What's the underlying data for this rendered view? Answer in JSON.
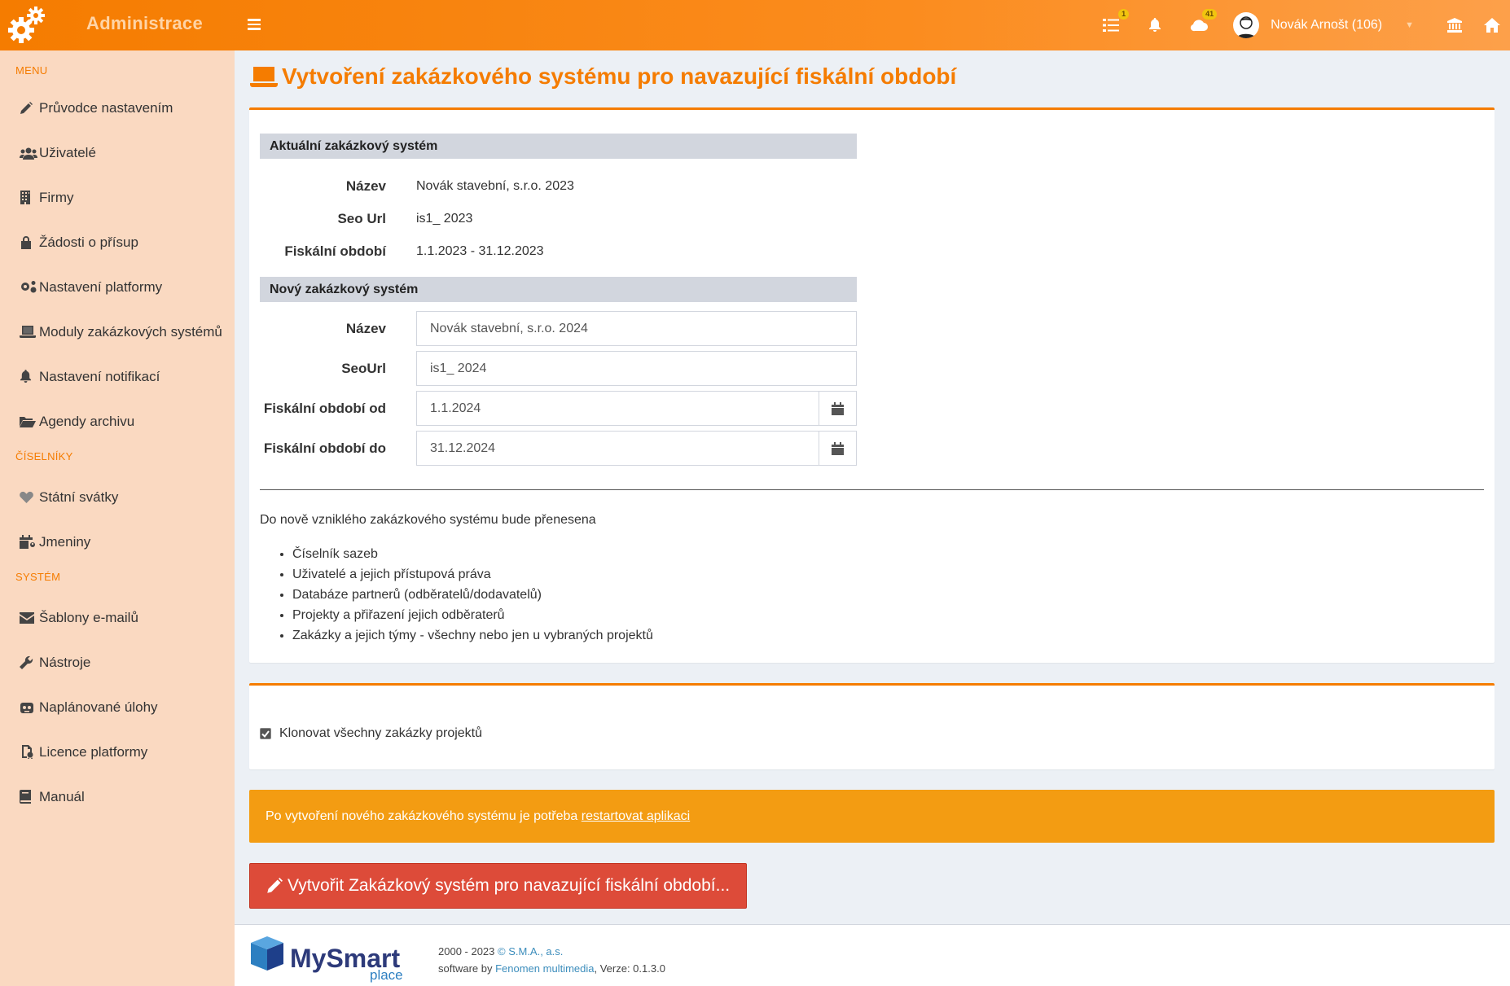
{
  "header": {
    "brand": "Administrace",
    "tasks_badge": "1",
    "messages_badge": "41",
    "user_name": "Novák Arnošt (106)"
  },
  "sidebar": {
    "menu_title": "MENU",
    "items_menu": [
      {
        "label": "Průvodce nastavením",
        "icon": "pencil-icon"
      },
      {
        "label": "Uživatelé",
        "icon": "users-icon"
      },
      {
        "label": "Firmy",
        "icon": "building-icon"
      },
      {
        "label": "Žádosti o přísup",
        "icon": "lock-icon"
      },
      {
        "label": "Nastavení platformy",
        "icon": "gears-icon"
      },
      {
        "label": "Moduly zakázkových systémů",
        "icon": "laptop-icon"
      },
      {
        "label": "Nastavení notifikací",
        "icon": "bell-icon"
      },
      {
        "label": "Agendy archivu",
        "icon": "folder-open-icon"
      }
    ],
    "codebooks_title": "ČÍSELNÍKY",
    "items_codebooks": [
      {
        "label": "Státní svátky",
        "icon": "heart-icon"
      },
      {
        "label": "Jmeniny",
        "icon": "calendar-user-icon"
      }
    ],
    "system_title": "SYSTÉM",
    "items_system": [
      {
        "label": "Šablony e-mailů",
        "icon": "envelope-icon"
      },
      {
        "label": "Nástroje",
        "icon": "wrench-icon"
      },
      {
        "label": "Naplánované úlohy",
        "icon": "robot-icon"
      },
      {
        "label": "Licence platformy",
        "icon": "license-icon"
      },
      {
        "label": "Manuál",
        "icon": "book-icon"
      }
    ]
  },
  "page": {
    "title": "Vytvoření zakázkového systému pro navazující fiskální období"
  },
  "current": {
    "heading": "Aktuální zakázkový systém",
    "name_label": "Název",
    "name_value": "Novák stavební, s.r.o. 2023",
    "seo_label": "Seo Url",
    "seo_value": "is1_ 2023",
    "period_label": "Fiskální období",
    "period_value": "1.1.2023 -  31.12.2023"
  },
  "new": {
    "heading": "Nový zakázkový systém",
    "name_label": "Název",
    "name_value": "Novák stavební, s.r.o. 2024",
    "seo_label": "SeoUrl",
    "seo_value": "is1_ 2024",
    "from_label": "Fiskální období od",
    "from_value": "1.1.2024",
    "to_label": "Fiskální období do",
    "to_value": "31.12.2024"
  },
  "transfer": {
    "intro": "Do nově vzniklého zakázkového systému bude přenesena",
    "items": [
      "Číselník sazeb",
      "Uživatelé a jejich přístupová práva",
      "Databáze partnerů (odběratelů/dodavatelů)",
      "Projekty a přiřazení jejich odběraterů",
      "Zakázky a jejich týmy - všechny nebo jen u vybraných projektů"
    ]
  },
  "clone": {
    "label": "Klonovat všechny zakázky projektů",
    "checked": true
  },
  "alert": {
    "text": "Po vytvoření nového zakázkového systému je potřeba ",
    "link": "restartovat aplikaci"
  },
  "submit": {
    "label": "Vytvořit Zakázkový systém pro navazující fiskální období..."
  },
  "footer": {
    "logo_main": "MySmart",
    "logo_sub": "place",
    "copyright_prefix": "2000 - 2023 ",
    "company": "© S.M.A., a.s.",
    "software_prefix": "software by ",
    "vendor": "Fenomen multimedia",
    "version": ", Verze: 0.1.3.0"
  },
  "colors": {
    "accent": "#f57c00",
    "sidebar_bg": "#fad9c1",
    "alert": "#f39c12",
    "danger": "#dd4b39"
  }
}
